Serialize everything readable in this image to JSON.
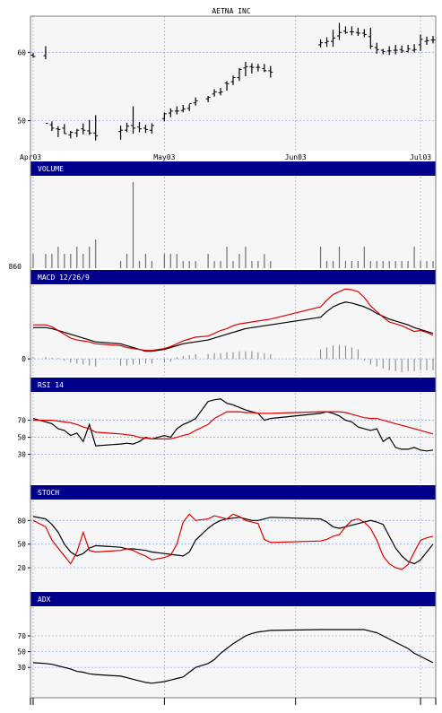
{
  "chart_data": [
    {
      "type": "ohlc",
      "title": "AETNA INC",
      "y_ticks": [
        60,
        50
      ],
      "ylim": [
        46.0,
        64.9
      ],
      "x_ticks": [
        "Apr03",
        "May03",
        "Jun03",
        "Jul03"
      ],
      "x_tick_days": [
        0,
        21,
        42,
        62
      ],
      "days": [
        0,
        2,
        3,
        4,
        5,
        6,
        7,
        8,
        9,
        10,
        14,
        15,
        16,
        17,
        18,
        19,
        21,
        22,
        23,
        24,
        25,
        26,
        28,
        29,
        30,
        31,
        32,
        33,
        34,
        35,
        36,
        37,
        38,
        46,
        47,
        48,
        49,
        50,
        51,
        52,
        53,
        54,
        55,
        56,
        57,
        58,
        59,
        60,
        61,
        62,
        63,
        64
      ],
      "open": [
        59.6,
        59.5,
        49.4,
        48.8,
        48.9,
        47.9,
        48.2,
        48.8,
        48.5,
        48.2,
        48.4,
        48.6,
        49.3,
        49.1,
        48.9,
        48.6,
        50.3,
        51.1,
        51.4,
        51.5,
        51.8,
        52.6,
        53.2,
        53.9,
        54.1,
        55.5,
        55.7,
        56.3,
        57.7,
        57.9,
        57.8,
        57.6,
        57.3,
        61.1,
        61.4,
        61.6,
        62.4,
        63.1,
        63.0,
        62.9,
        62.8,
        62.3,
        60.7,
        60.3,
        60.2,
        60.3,
        60.4,
        60.1,
        60.3,
        61.1,
        61.6,
        61.8
      ],
      "high": [
        59.9,
        60.9,
        49.9,
        49.2,
        49.5,
        48.5,
        48.8,
        49.6,
        50.1,
        50.8,
        49.3,
        49.7,
        52.1,
        49.8,
        49.4,
        49.6,
        51.2,
        51.8,
        52.1,
        52.3,
        52.4,
        53.4,
        53.6,
        54.6,
        54.8,
        55.8,
        56.6,
        57.7,
        58.6,
        58.4,
        58.3,
        58.3,
        58.0,
        61.9,
        62.2,
        63.3,
        64.3,
        63.8,
        63.8,
        63.6,
        63.4,
        63.6,
        61.4,
        60.5,
        60.9,
        61.1,
        61.0,
        61.1,
        61.2,
        62.6,
        62.3,
        62.4
      ],
      "low": [
        59.2,
        59.0,
        48.5,
        47.6,
        48.1,
        47.4,
        47.6,
        48.0,
        47.9,
        47.1,
        47.2,
        48.3,
        48.1,
        48.3,
        48.2,
        48.1,
        49.9,
        50.5,
        50.9,
        51.2,
        51.4,
        52.2,
        52.7,
        53.5,
        53.7,
        54.4,
        55.2,
        55.8,
        56.5,
        56.9,
        57.2,
        57.1,
        56.3,
        60.7,
        60.8,
        60.8,
        61.8,
        62.7,
        62.5,
        62.4,
        62.2,
        60.5,
        59.8,
        59.7,
        59.6,
        59.7,
        59.9,
        60.0,
        60.0,
        60.2,
        61.1,
        61.3
      ],
      "close": [
        59.4,
        49.6,
        48.9,
        48.7,
        48.1,
        48.3,
        48.6,
        48.6,
        48.2,
        47.8,
        48.6,
        49.2,
        48.9,
        48.8,
        48.7,
        49.3,
        51.0,
        51.4,
        51.4,
        51.7,
        52.5,
        52.9,
        53.4,
        54.2,
        54.2,
        55.4,
        56.3,
        57.5,
        57.9,
        57.8,
        57.8,
        57.3,
        57.1,
        61.4,
        61.6,
        62.1,
        62.9,
        62.9,
        63.0,
        62.8,
        62.6,
        60.9,
        60.4,
        60.1,
        60.2,
        60.3,
        60.2,
        60.5,
        60.4,
        61.9,
        61.7,
        61.8
      ]
    },
    {
      "type": "bar",
      "title": "VOLUME",
      "y_ticks": [
        "860"
      ],
      "values": [
        0.2,
        0.2,
        0.2,
        0.3,
        0.2,
        0.2,
        0.3,
        0.2,
        0.3,
        0.4,
        0.1,
        0.2,
        1.2,
        0.1,
        0.2,
        0.1,
        0.2,
        0.2,
        0.2,
        0.1,
        0.1,
        0.1,
        0.2,
        0.1,
        0.1,
        0.3,
        0.1,
        0.2,
        0.3,
        0.1,
        0.1,
        0.2,
        0.1,
        0.3,
        0.1,
        0.1,
        0.3,
        0.1,
        0.1,
        0.1,
        0.3,
        0.1,
        0.1,
        0.1,
        0.1,
        0.1,
        0.1,
        0.1,
        0.3,
        0.1,
        0.1,
        0.1
      ]
    },
    {
      "type": "line",
      "title": "MACD 12/26/9",
      "y_ticks": [
        "0"
      ],
      "ylim": [
        -0.15,
        0.75
      ],
      "series": [
        {
          "color": "#000000",
          "values": [
            0.33,
            0.33,
            0.32,
            0.3,
            0.28,
            0.26,
            0.24,
            0.22,
            0.2,
            0.18,
            0.16,
            0.14,
            0.12,
            0.1,
            0.08,
            0.08,
            0.1,
            0.12,
            0.14,
            0.16,
            0.17,
            0.18,
            0.2,
            0.22,
            0.24,
            0.26,
            0.28,
            0.3,
            0.32,
            0.33,
            0.34,
            0.35,
            0.36,
            0.44,
            0.5,
            0.55,
            0.58,
            0.6,
            0.59,
            0.57,
            0.55,
            0.52,
            0.48,
            0.45,
            0.42,
            0.4,
            0.38,
            0.36,
            0.33,
            0.31,
            0.29,
            0.27
          ]
        },
        {
          "color": "#e00000",
          "values": [
            0.36,
            0.36,
            0.34,
            0.3,
            0.26,
            0.22,
            0.2,
            0.19,
            0.18,
            0.16,
            0.14,
            0.12,
            0.11,
            0.1,
            0.09,
            0.09,
            0.11,
            0.13,
            0.16,
            0.19,
            0.21,
            0.23,
            0.24,
            0.27,
            0.3,
            0.32,
            0.35,
            0.37,
            0.38,
            0.39,
            0.4,
            0.41,
            0.42,
            0.55,
            0.62,
            0.68,
            0.71,
            0.74,
            0.73,
            0.71,
            0.65,
            0.56,
            0.5,
            0.44,
            0.39,
            0.37,
            0.35,
            0.32,
            0.29,
            0.3,
            0.28,
            0.25
          ]
        }
      ],
      "histogram": [
        0.02,
        0.02,
        0.01,
        0.01,
        -0.02,
        -0.04,
        -0.05,
        -0.06,
        -0.07,
        -0.08,
        -0.07,
        -0.07,
        -0.06,
        -0.06,
        -0.05,
        -0.05,
        -0.04,
        -0.03,
        0.02,
        0.03,
        0.04,
        0.05,
        0.05,
        0.06,
        0.06,
        0.07,
        0.07,
        0.08,
        0.08,
        0.08,
        0.07,
        0.06,
        0.05,
        0.1,
        0.12,
        0.14,
        0.15,
        0.14,
        0.12,
        0.1,
        -0.02,
        -0.06,
        -0.08,
        -0.1,
        -0.12,
        -0.13,
        -0.14,
        -0.13,
        -0.13,
        -0.12,
        -0.12,
        -0.12
      ]
    },
    {
      "type": "line",
      "title": "RSI 14",
      "y_ticks": [
        70,
        50,
        30
      ],
      "ylim": [
        -1,
        99
      ],
      "series": [
        {
          "color": "#000000",
          "values": [
            72,
            68,
            66,
            60,
            58,
            52,
            55,
            45,
            65,
            40,
            42,
            43,
            42,
            45,
            50,
            48,
            52,
            50,
            60,
            65,
            68,
            72,
            92,
            94,
            95,
            90,
            88,
            85,
            82,
            80,
            78,
            70,
            72,
            78,
            80,
            78,
            75,
            70,
            68,
            62,
            60,
            58,
            60,
            45,
            50,
            38,
            36,
            36,
            38,
            35,
            34,
            35
          ]
        },
        {
          "color": "#e00000",
          "values": [
            70,
            70,
            70,
            69,
            68,
            67,
            65,
            62,
            60,
            56,
            54,
            53,
            52,
            50,
            49,
            48,
            48,
            48,
            50,
            52,
            54,
            58,
            65,
            72,
            76,
            80,
            80,
            80,
            79,
            79,
            78,
            78,
            78,
            80,
            80,
            80,
            80,
            79,
            77,
            75,
            73,
            72,
            72,
            70,
            68,
            66,
            64,
            62,
            60,
            58,
            56,
            54
          ]
        }
      ]
    },
    {
      "type": "line",
      "title": "STOCH",
      "y_ticks": [
        80,
        50,
        20
      ],
      "ylim": [
        -5,
        102
      ],
      "series": [
        {
          "color": "#000000",
          "values": [
            85,
            82,
            75,
            65,
            50,
            40,
            35,
            38,
            45,
            48,
            46,
            44,
            44,
            43,
            42,
            40,
            38,
            37,
            36,
            35,
            40,
            55,
            70,
            76,
            80,
            82,
            83,
            84,
            82,
            80,
            80,
            82,
            84,
            82,
            78,
            72,
            70,
            72,
            74,
            76,
            78,
            80,
            78,
            75,
            60,
            45,
            35,
            28,
            25,
            30,
            40,
            50
          ]
        },
        {
          "color": "#e00000",
          "values": [
            80,
            72,
            55,
            45,
            35,
            25,
            40,
            65,
            42,
            40,
            42,
            44,
            42,
            38,
            35,
            30,
            33,
            36,
            50,
            78,
            88,
            80,
            82,
            86,
            84,
            82,
            88,
            85,
            80,
            78,
            76,
            56,
            52,
            54,
            56,
            60,
            62,
            72,
            80,
            82,
            78,
            70,
            55,
            35,
            25,
            20,
            18,
            24,
            40,
            55,
            58,
            60
          ]
        }
      ]
    },
    {
      "type": "line",
      "title": "ADX",
      "y_ticks": [
        70,
        50,
        30
      ],
      "ylim": [
        -5,
        103
      ],
      "series": [
        {
          "color": "#000000",
          "values": [
            36,
            35,
            34,
            32,
            30,
            28,
            25,
            24,
            22,
            21,
            19,
            17,
            15,
            13,
            11,
            10,
            12,
            14,
            16,
            18,
            24,
            30,
            35,
            40,
            48,
            54,
            60,
            65,
            70,
            73,
            75,
            76,
            77,
            78,
            78,
            78,
            78,
            78,
            78,
            78,
            78,
            76,
            74,
            70,
            66,
            62,
            58,
            54,
            48,
            44,
            40,
            36
          ]
        }
      ]
    }
  ]
}
